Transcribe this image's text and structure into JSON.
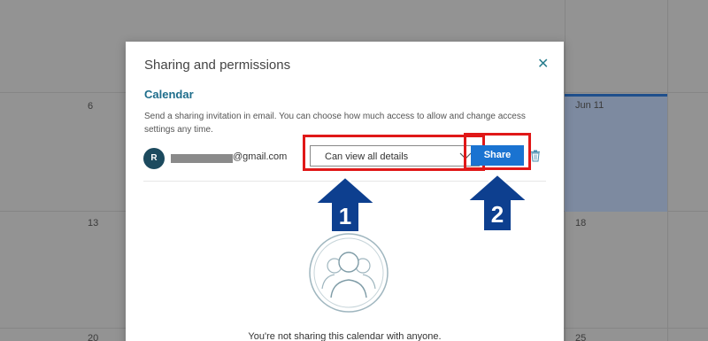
{
  "calendar": {
    "day_labels": [
      "6",
      "Jun 11",
      "13",
      "18",
      "20",
      "25"
    ]
  },
  "modal": {
    "title": "Sharing and permissions",
    "close_icon": "close-icon",
    "section_heading": "Calendar",
    "description": "Send a sharing invitation in email. You can choose how much access to allow and change access settings any time.",
    "share_row": {
      "avatar_initial": "R",
      "email_suffix": "@gmail.com",
      "permission_value": "Can view all details",
      "share_label": "Share",
      "delete_icon": "trash-icon"
    },
    "empty_message": "You're not sharing this calendar with anyone."
  },
  "annotations": {
    "step_1": "1",
    "step_2": "2",
    "highlight_color": "#e01818",
    "arrow_color": "#0d3f8f"
  }
}
